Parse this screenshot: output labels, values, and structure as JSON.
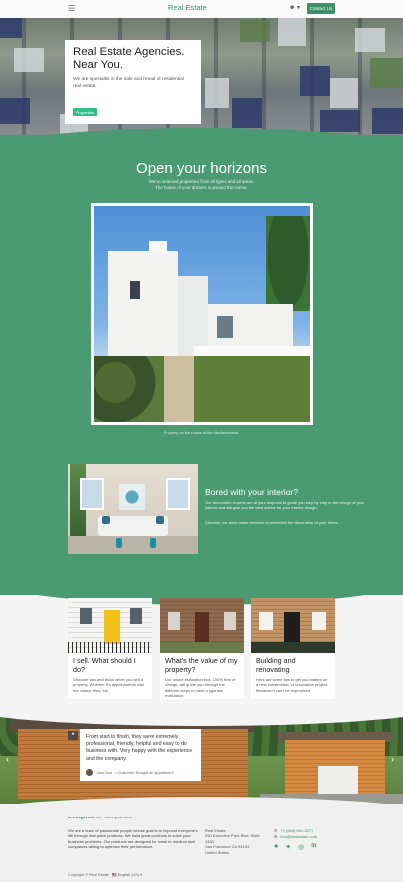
{
  "nav": {
    "menu_icon": "hamburger-icon",
    "brand": "Real Estate",
    "lang": "☻ ▾",
    "contact_label": "Contact Us"
  },
  "hero": {
    "title": "Real Estate Agencies. Near You.",
    "text": "We are specialist in the sale and rental of residential real estate.",
    "button": "Properties"
  },
  "horizons": {
    "title": "Open your horizons",
    "subtitle_line1": "We've selected properties from all types and all areas.",
    "subtitle_line2": "The house of your dreams is around the corner.",
    "caption": "Property on the coasts of the Mediterranean."
  },
  "interior": {
    "title": "Bored with your interior?",
    "text1": "Our decoration experts are at your disposal to guide you step by step in the design of your interior and will give you the best advice for your interior design.",
    "text2": "Discover our tailor-made services to embellish the decoration of your home."
  },
  "cards": [
    {
      "title": "I sell. What should I do?",
      "text": "Discover tips and tricks when you sell a property. Whether it's appointments with the notary, fees, etc."
    },
    {
      "title": "What's the value of my property?",
      "text": "Our online estimation tool, 100% free of charge, will guide you through the different steps to have a rigorous evaluation."
    },
    {
      "title": "Building and renovating",
      "text": "Here are some tips to get you started on a new construction or renovation project. Because it can't be improvised."
    }
  ],
  "testimonial": {
    "quote": "From start to finish, they were extremely professional, friendly, helpful and easy to do business with. Very happy with the experience and the company.",
    "person": "John Doe",
    "role": "• Customer, Bought an appartment",
    "prev": "‹",
    "next": "›",
    "badge": "❝"
  },
  "footer": {
    "title_bold": "Designed",
    "title_rest": " for companies",
    "about": "We are a team of passionate people whose goal is to improve everyone's life through disruptive products. We build great products to solve your business problems. Our products are designed for small to medium size companies willing to optimize their performance.",
    "addr_line1": "Real Estate",
    "addr_line2": "250 Executive Park Blvd, Suite 3400",
    "addr_line3": "San Francisco CA 94134",
    "addr_line4": "United States",
    "phone": "+1 (650) 691-3277",
    "email": "info@realestate.com",
    "copyright": "Copyright © Real Estate",
    "language": "🇺🇸 English (US) ▾"
  }
}
